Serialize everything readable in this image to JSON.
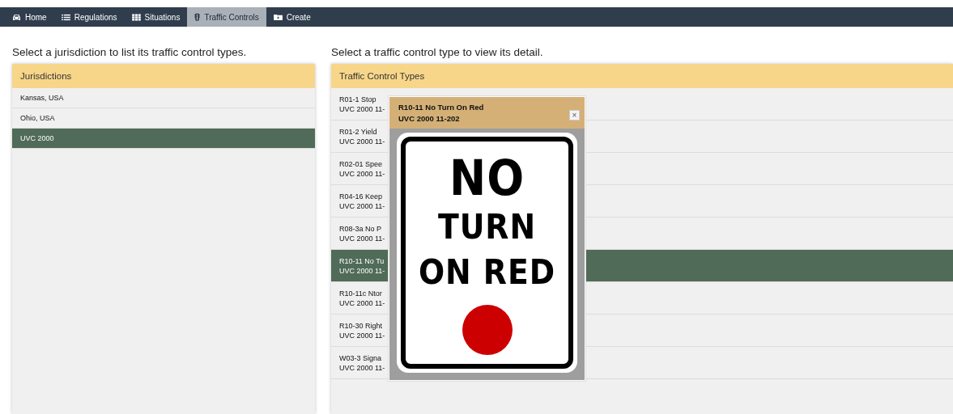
{
  "nav": [
    {
      "label": "Home",
      "selected": false
    },
    {
      "label": "Regulations",
      "selected": false
    },
    {
      "label": "Situations",
      "selected": false
    },
    {
      "label": "Traffic Controls",
      "selected": true
    },
    {
      "label": "Create",
      "selected": false
    }
  ],
  "left": {
    "instruction": "Select a jurisdiction to list its traffic control types.",
    "heading": "Jurisdictions",
    "items": [
      {
        "label": "Kansas, USA",
        "selected": false
      },
      {
        "label": "Ohio, USA",
        "selected": false
      },
      {
        "label": "UVC 2000",
        "selected": true
      }
    ]
  },
  "right": {
    "instruction": "Select a traffic control type to view its detail.",
    "heading": "Traffic Control Types",
    "items": [
      {
        "title": "R01-1 Stop",
        "code": "UVC 2000 11-",
        "selected": false
      },
      {
        "title": "R01-2 Yield",
        "code": "UVC 2000 11-",
        "selected": false
      },
      {
        "title": "R02-01 Spee",
        "code": "UVC 2000 11-",
        "selected": false
      },
      {
        "title": "R04-16 Keep",
        "code": "UVC 2000 11-",
        "selected": false
      },
      {
        "title": "R08-3a No P",
        "code": "UVC 2000 11-",
        "selected": false
      },
      {
        "title": "R10-11 No Tu",
        "code": "UVC 2000 11-",
        "selected": true
      },
      {
        "title": "R10-11c Ntor",
        "code": "UVC 2000 11-",
        "selected": false
      },
      {
        "title": "R10-30 Right",
        "code": "UVC 2000 11-",
        "selected": false
      },
      {
        "title": "W03-3 Signa",
        "code": "UVC 2000 11-",
        "selected": false
      }
    ]
  },
  "popup": {
    "title": "R10-11 No Turn On Red",
    "subtitle": "UVC 2000 11-202",
    "close": "×",
    "sign_lines": [
      "NO",
      "TURN",
      "ON RED"
    ]
  }
}
